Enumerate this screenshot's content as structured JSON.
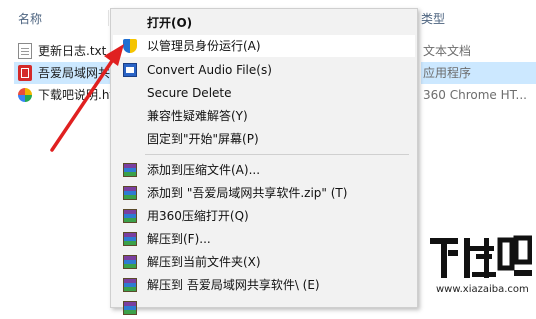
{
  "explorer": {
    "columns": {
      "name": "名称",
      "type": "类型"
    },
    "files": [
      {
        "name": "更新日志.txt",
        "type": "文本文档",
        "icon": "text-file-icon",
        "selected": false
      },
      {
        "name": "吾爱局域网共享软件.exe",
        "type": "应用程序",
        "icon": "app-icon",
        "selected": true
      },
      {
        "name": "下载吧说明.htm",
        "type": "360 Chrome HT...",
        "icon": "html-file-icon",
        "selected": false
      }
    ]
  },
  "context_menu": {
    "items": [
      {
        "label": "打开(O)",
        "icon": "",
        "bold": true
      },
      {
        "label": "以管理员身份运行(A)",
        "icon": "shield-icon"
      },
      {
        "label": "Convert Audio File(s)",
        "icon": "convert-audio-icon"
      },
      {
        "label": "Secure Delete",
        "icon": ""
      },
      {
        "label": "兼容性疑难解答(Y)",
        "icon": ""
      },
      {
        "label": "固定到\"开始\"屏幕(P)",
        "icon": ""
      },
      {
        "label": "添加到压缩文件(A)...",
        "icon": "winrar-icon"
      },
      {
        "label": "添加到 \"吾爱局域网共享软件.zip\" (T)",
        "icon": "winrar-icon"
      },
      {
        "label": "用360压缩打开(Q)",
        "icon": "winrar-icon"
      },
      {
        "label": "解压到(F)...",
        "icon": "winrar-icon"
      },
      {
        "label": "解压到当前文件夹(X)",
        "icon": "winrar-icon"
      },
      {
        "label": "解压到 吾爱局域网共享软件\\ (E)",
        "icon": "winrar-icon"
      }
    ]
  },
  "watermark": {
    "logo_text": "下载吧",
    "url": "www.xiazaiba.com"
  },
  "colors": {
    "selection": "#cce8ff",
    "menu_bg": "#f2f2f2",
    "arrow": "#e02020"
  }
}
